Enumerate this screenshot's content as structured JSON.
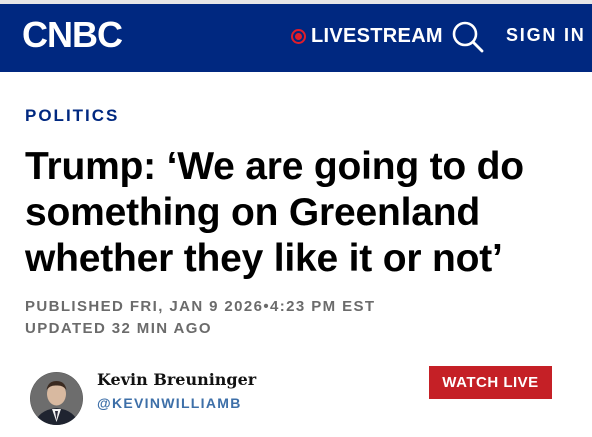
{
  "header": {
    "logo": "CNBC",
    "livestream_label": "LIVESTREAM",
    "signin_label": "SIGN IN",
    "icons": {
      "live": "live-dot-icon",
      "search": "search-icon"
    },
    "colors": {
      "bar": "#002880",
      "live": "#e11d2a"
    }
  },
  "article": {
    "section": "POLITICS",
    "headline": "Trump: ‘We are going to do something on Greenland whether they like it or not’",
    "published": "PUBLISHED FRI, JAN 9 2026•4:23 PM EST",
    "updated": "UPDATED 32 MIN AGO"
  },
  "author": {
    "name": "Kevin Breuninger",
    "handle": "@KEVINWILLIAMB"
  },
  "watch_live": {
    "label": "WATCH LIVE",
    "color": "#c52026"
  }
}
